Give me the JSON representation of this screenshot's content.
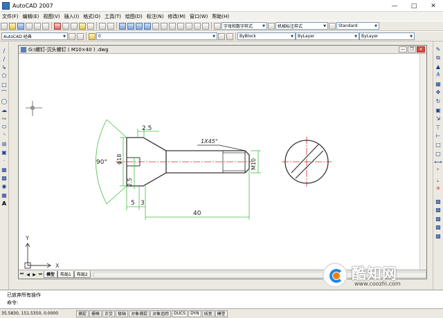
{
  "window": {
    "title": "AutoCAD 2007"
  },
  "menu": [
    "文件(F)",
    "编辑(E)",
    "视图(V)",
    "插入(I)",
    "格式(O)",
    "工具(T)",
    "绘图(D)",
    "标注(N)",
    "修改(M)",
    "窗口(W)",
    "帮助(H)"
  ],
  "toolbar1": {
    "text_style": "字母和数字样式",
    "dim_style": "机械标注样式",
    "table_style": "Standard"
  },
  "toolbar2": {
    "workspace": "AutoCAD 经典",
    "layer": "0",
    "color": "ByBlock",
    "linetype": "ByLayer",
    "lineweight": "ByLayer"
  },
  "document": {
    "title": "G:\\螺钉-沉头螺钉 ( M10×40 ) .dwg"
  },
  "drawing": {
    "dims": {
      "d_2_5_top": "2.5",
      "chamfer": "1X45°",
      "angle": "90°",
      "phi18": "ϕ18",
      "d_2_5_side": "2.5",
      "d_5": "5",
      "d_3": "3",
      "d_40": "40",
      "m10": "M10"
    },
    "ucs": {
      "x": "X",
      "y": "Y"
    }
  },
  "tabs": [
    "模型",
    "布局1",
    "布局2"
  ],
  "command": {
    "history": "已放弃所有操作",
    "prompt": "命令:"
  },
  "status": {
    "coords": "35.5830,  151.5350,  0.0000",
    "buttons": [
      "捕捉",
      "栅格",
      "正交",
      "极轴",
      "对象捕捉",
      "对象追踪",
      "DUCS",
      "DYN",
      "线宽",
      "模型"
    ]
  },
  "watermark": {
    "name": "酷知网",
    "url": "www.coozhi.com"
  },
  "colors": {
    "dim_green": "#3fbf3f",
    "center_red": "#d9242a",
    "body": "#333333"
  }
}
